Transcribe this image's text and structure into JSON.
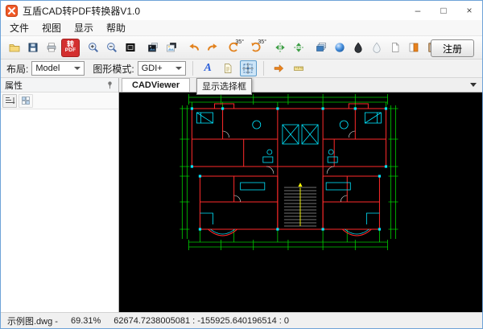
{
  "window": {
    "title": "互盾CAD转PDF转换器V1.0",
    "minimize": "–",
    "maximize": "□",
    "close": "×"
  },
  "menubar": {
    "items": [
      "文件",
      "视图",
      "显示",
      "帮助"
    ]
  },
  "toolbar": {
    "pdf_top": "转",
    "pdf_bottom": "PDF",
    "rotate_left_label": "35°",
    "rotate_right_label": "35°",
    "register": "注册",
    "icon_names": [
      "open-folder",
      "save-floppy",
      "printer",
      "convert-pdf",
      "zoom-in",
      "zoom-out",
      "fit-extents",
      "dark-image",
      "light-image",
      "undo",
      "redo",
      "rotate-left-35",
      "rotate-right-35",
      "flip-horizontal",
      "flip-vertical",
      "layers",
      "render-sphere",
      "dark-droplet",
      "light-droplet",
      "white-page",
      "two-color-page",
      "clipboard-copy"
    ]
  },
  "optionsbar": {
    "layout_label": "布局:",
    "layout_value": "Model",
    "mode_label": "图形模式:",
    "mode_value": "GDI+",
    "icon_names": [
      "font-quality",
      "page-setup",
      "selection-box",
      "pan-arrow",
      "ruler"
    ]
  },
  "icons": {
    "font_glyph": "A"
  },
  "sidebar": {
    "title": "属性"
  },
  "viewer": {
    "tab": "CADViewer",
    "tooltip": "显示选择框"
  },
  "statusbar": {
    "file": "示例图.dwg -",
    "zoom": "69.31%",
    "coords": "62674.7238005081 : -155925.640196514 : 0"
  },
  "colors": {
    "pdf_button": "#d32f2f",
    "canvas_bg": "#000000",
    "cad_walls": "#ff2a2a",
    "cad_fixtures": "#00e5ff",
    "cad_dimensions": "#00cc00",
    "accent_orange": "#e2821e",
    "accent_green": "#3d9e44"
  }
}
